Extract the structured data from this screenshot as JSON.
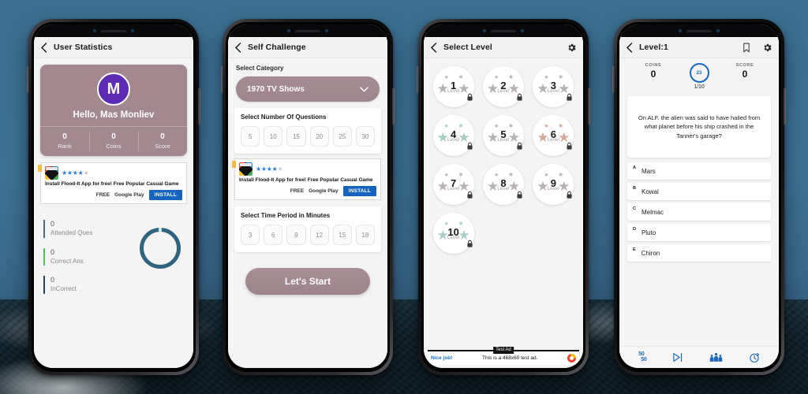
{
  "background": {
    "sky_color": "#3d7193",
    "ground_color": "#132730"
  },
  "phones": [
    {
      "id": "user-statistics",
      "appbar": {
        "back_icon": "chevron-left-icon",
        "title": "User Statistics"
      },
      "profile": {
        "avatar_letter": "M",
        "greeting": "Hello, Mas Monliev",
        "stats": [
          {
            "value": "0",
            "label": "Rank"
          },
          {
            "value": "0",
            "label": "Coins"
          },
          {
            "value": "0",
            "label": "Score"
          }
        ]
      },
      "ad": {
        "stars_filled": 4,
        "stars_total": 5,
        "text": "Install Flood-It App for free! Free Popular Casual Game",
        "price": "FREE",
        "store": "Google Play",
        "cta": "INSTALL"
      },
      "counters": [
        {
          "value": "0",
          "label": "Attended Ques",
          "color": "#4a6b80"
        },
        {
          "value": "0",
          "label": "Correct Ans",
          "color": "#46c45c"
        },
        {
          "value": "0",
          "label": "InCorrect",
          "color": "#26475f"
        }
      ],
      "donut": {
        "progress_percent": 0,
        "color": "#2f6480"
      }
    },
    {
      "id": "self-challenge",
      "appbar": {
        "back_icon": "chevron-left-icon",
        "title": "Self Challenge"
      },
      "category": {
        "label": "Select Category",
        "selected": "1970 TV Shows",
        "chevron_icon": "chevron-down-icon"
      },
      "questions": {
        "title": "Select Number Of Questions",
        "options": [
          "5",
          "10",
          "15",
          "20",
          "25",
          "30"
        ]
      },
      "ad": {
        "stars_filled": 4,
        "stars_total": 5,
        "text": "Install Flood-It App for free! Free Popular Casual Game",
        "price": "FREE",
        "store": "Google Play",
        "cta": "INSTALL"
      },
      "time": {
        "title": "Select Time Period in Minutes",
        "options": [
          "3",
          "6",
          "9",
          "12",
          "15",
          "18"
        ]
      },
      "start_button": "Let's Start"
    },
    {
      "id": "select-level",
      "appbar": {
        "back_icon": "chevron-left-icon",
        "title": "Select Level",
        "settings_icon": "gear-icon"
      },
      "level_word": "Level",
      "levels": [
        {
          "number": "1",
          "locked": true,
          "star_tone": "grey"
        },
        {
          "number": "2",
          "locked": true,
          "star_tone": "grey"
        },
        {
          "number": "3",
          "locked": true,
          "star_tone": "grey"
        },
        {
          "number": "4",
          "locked": true,
          "star_tone": "teal"
        },
        {
          "number": "5",
          "locked": true,
          "star_tone": "grey"
        },
        {
          "number": "6",
          "locked": true,
          "star_tone": "rose"
        },
        {
          "number": "7",
          "locked": true,
          "star_tone": "grey"
        },
        {
          "number": "8",
          "locked": true,
          "star_tone": "grey"
        },
        {
          "number": "9",
          "locked": true,
          "star_tone": "grey"
        },
        {
          "number": "10",
          "locked": true,
          "star_tone": "teal"
        }
      ],
      "admob": {
        "badge": "Test Ad",
        "link": "Nice job!",
        "text": "This is a 468x60 test ad.",
        "logo_icon": "admob-logo-icon"
      }
    },
    {
      "id": "quiz-level-1",
      "appbar": {
        "back_icon": "chevron-left-icon",
        "title": "Level:1",
        "bookmark_icon": "bookmark-icon",
        "settings_icon": "gear-icon"
      },
      "hud": {
        "coins_label": "COINS",
        "coins_value": "0",
        "timer_value": "23",
        "progress": "1/10",
        "score_label": "SCORE",
        "score_value": "0",
        "timer_color": "#1668c4"
      },
      "question": "On ALF. the alien was said to have hailed from what planet before his ship crashed in the Tanner's garage?",
      "answers": [
        {
          "key": "A",
          "text": "Mars"
        },
        {
          "key": "B",
          "text": "Kowal"
        },
        {
          "key": "C",
          "text": "Melmac"
        },
        {
          "key": "D",
          "text": "Pluto"
        },
        {
          "key": "E",
          "text": "Chiron"
        }
      ],
      "lifelines": [
        {
          "icon": "fifty-fifty-icon",
          "top": "50",
          "bottom": "50"
        },
        {
          "icon": "skip-next-icon"
        },
        {
          "icon": "audience-poll-icon"
        },
        {
          "icon": "extra-time-icon"
        }
      ]
    }
  ]
}
